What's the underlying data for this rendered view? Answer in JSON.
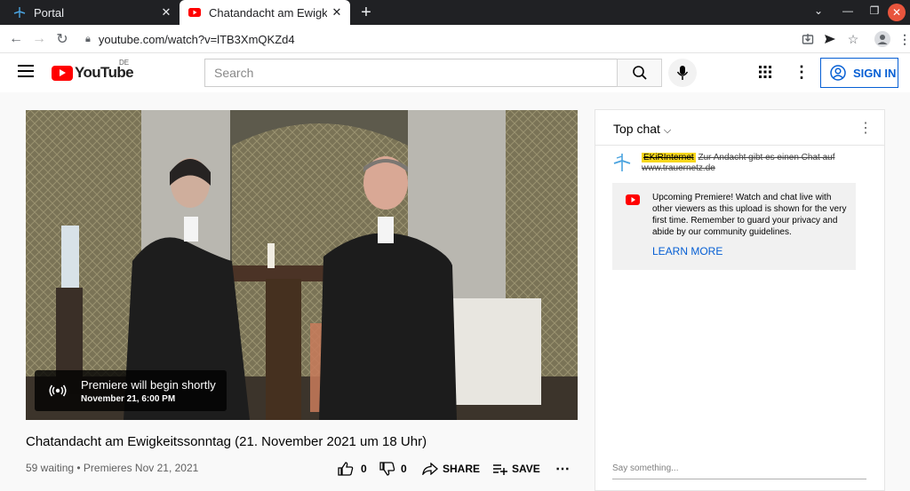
{
  "browser": {
    "tabs": [
      {
        "title": "Portal",
        "active": false
      },
      {
        "title": "Chatandacht am Ewigkeit",
        "active": true
      }
    ],
    "url": "youtube.com/watch?v=lTB3XmQKZd4"
  },
  "youtube": {
    "logo_text": "YouTube",
    "region": "DE",
    "search_placeholder": "Search",
    "signin_label": "SIGN IN"
  },
  "player": {
    "premiere_title": "Premiere will begin shortly",
    "premiere_date": "November 21, 6:00 PM"
  },
  "video": {
    "title": "Chatandacht am Ewigkeitssonntag (21. November 2021 um 18 Uhr)",
    "meta": "59 waiting • Premieres Nov 21, 2021",
    "likes": "0",
    "dislikes": "0",
    "share_label": "SHARE",
    "save_label": "SAVE"
  },
  "chat": {
    "header": "Top chat",
    "message_author": "EKiRInternet",
    "message_text": "Zur Andacht gibt es einen Chat auf www.trauernetz.de",
    "notice_text": "Upcoming Premiere! Watch and chat live with other viewers as this upload is shown for the very first time. Remember to guard your privacy and abide by our community guidelines.",
    "learn_more": "LEARN MORE",
    "input_placeholder": "Say something..."
  },
  "colors": {
    "brand_red": "#ff0000",
    "link_blue": "#065fd4",
    "highlight": "#f8d81b"
  }
}
